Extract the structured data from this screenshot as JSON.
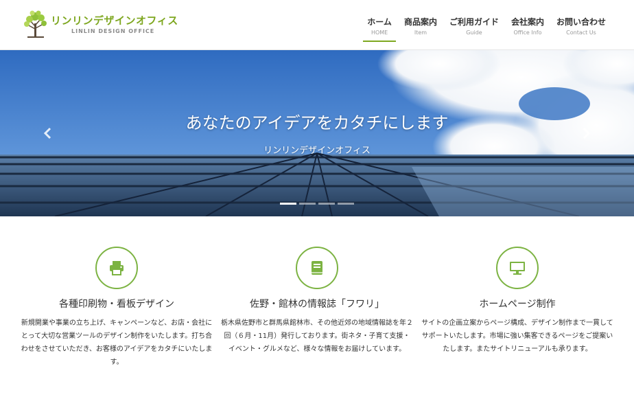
{
  "brand": {
    "name": "リンリンデザインオフィス",
    "tagline": "LINLIN DESIGN OFFICE",
    "color": "#7ea720"
  },
  "nav": [
    {
      "label": "ホーム",
      "sub": "HOME",
      "active": true
    },
    {
      "label": "商品案内",
      "sub": "Item",
      "active": false
    },
    {
      "label": "ご利用ガイド",
      "sub": "Guide",
      "active": false
    },
    {
      "label": "会社案内",
      "sub": "Office Info",
      "active": false
    },
    {
      "label": "お問い合わせ",
      "sub": "Contact Us",
      "active": false
    }
  ],
  "hero": {
    "title": "あなたのアイデアをカタチにします",
    "subtitle": "リンリンデザインオフィス",
    "prev_icon": "chevron-left-icon",
    "next_icon": "chevron-right-icon",
    "slide_count": 4,
    "active_slide": 1
  },
  "services": [
    {
      "icon": "printer-icon",
      "title": "各種印刷物・看板デザイン",
      "description": "新規開業や事業の立ち上げ、キャンペーンなど、お店・会社にとって大切な営業ツールのデザイン制作をいたします。打ち合わせをさせていただき、お客様のアイデアをカタチにいたします。"
    },
    {
      "icon": "book-icon",
      "title": "佐野・館林の情報誌「フワリ」",
      "description": "栃木県佐野市と群馬県館林市、その他近郊の地域情報誌を年２回（６月・11月）発行しております。街ネタ・子育て支援・イベント・グルメなど、様々な情報をお届けしています。"
    },
    {
      "icon": "monitor-icon",
      "title": "ホームページ制作",
      "description": "サイトの企画立案からページ構成、デザイン制作まで一貫してサポートいたします。市場に強い集客できるページをご提案いたします。またサイトリニューアルも承ります。"
    }
  ],
  "colors": {
    "accent": "#7cb342",
    "sky": "#3f78c9"
  }
}
